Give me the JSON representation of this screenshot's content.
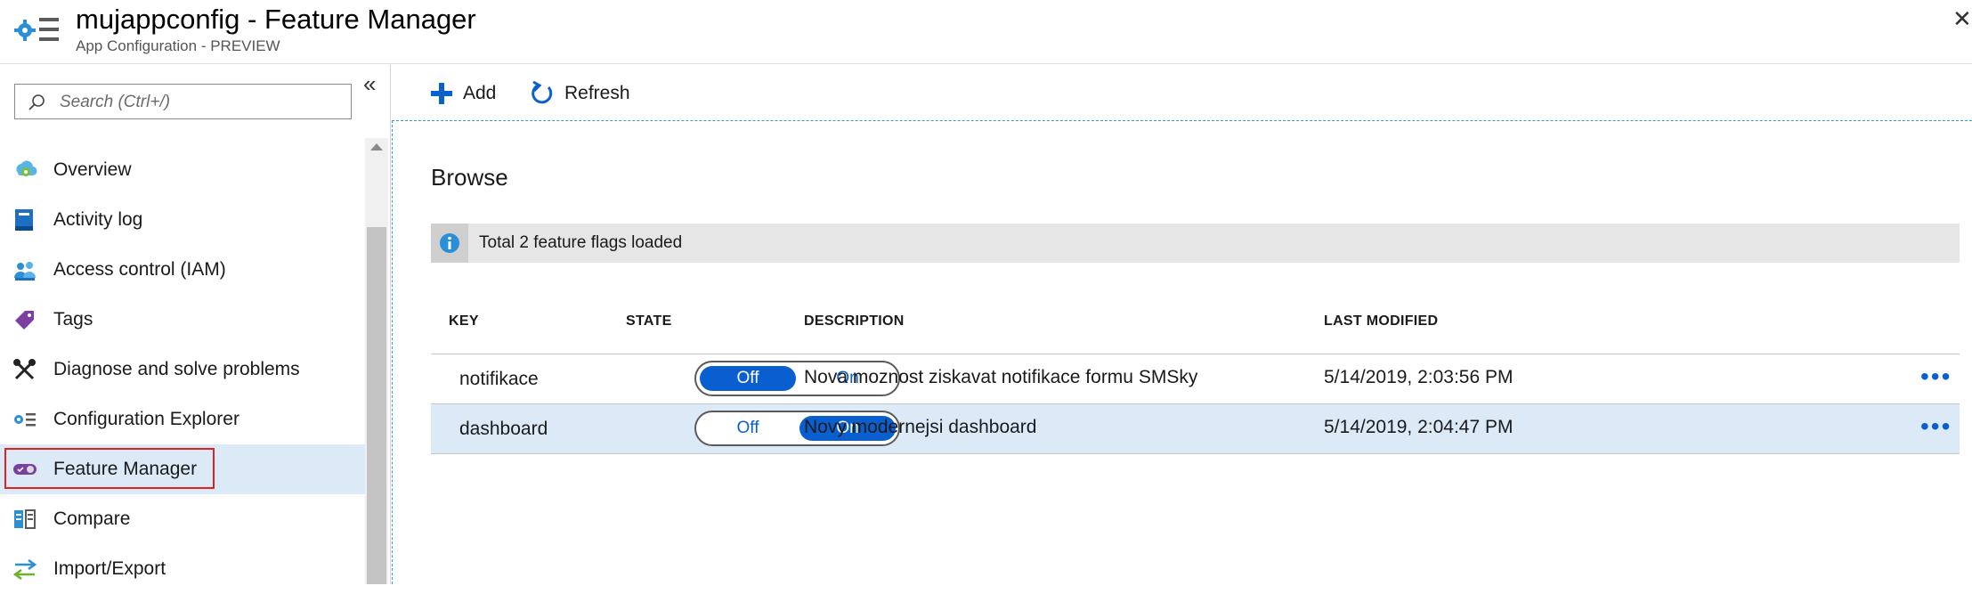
{
  "header": {
    "title": "mujappconfig - Feature Manager",
    "subtitle": "App Configuration - PREVIEW",
    "close_glyph": "✕"
  },
  "sidebar": {
    "search_placeholder": "Search (Ctrl+/)",
    "collapse_glyph": "«",
    "items": [
      {
        "label": "Overview",
        "icon": "overview-icon"
      },
      {
        "label": "Activity log",
        "icon": "activity-log-icon"
      },
      {
        "label": "Access control (IAM)",
        "icon": "access-control-icon"
      },
      {
        "label": "Tags",
        "icon": "tag-icon"
      },
      {
        "label": "Diagnose and solve problems",
        "icon": "wrench-icon"
      },
      {
        "label": "Configuration Explorer",
        "icon": "configuration-explorer-icon"
      },
      {
        "label": "Feature Manager",
        "icon": "feature-manager-icon",
        "active": true
      },
      {
        "label": "Compare",
        "icon": "compare-icon"
      },
      {
        "label": "Import/Export",
        "icon": "import-export-icon"
      }
    ]
  },
  "toolbar": {
    "add_label": "Add",
    "refresh_label": "Refresh"
  },
  "main": {
    "section_title": "Browse",
    "info_text": "Total 2 feature flags loaded",
    "columns": {
      "key": "KEY",
      "state": "STATE",
      "description": "DESCRIPTION",
      "last_modified": "LAST MODIFIED"
    },
    "rows": [
      {
        "key": "notifikace",
        "state": "Off",
        "off_label": "Off",
        "on_label": "On",
        "description": "Nova moznost ziskavat notifikace formu SMSky",
        "last_modified": "5/14/2019, 2:03:56 PM",
        "more": "•••"
      },
      {
        "key": "dashboard",
        "state": "On",
        "off_label": "Off",
        "on_label": "On",
        "description": "Novy modernejsi dashboard",
        "last_modified": "5/14/2019, 2:04:47 PM",
        "more": "•••"
      }
    ]
  },
  "colors": {
    "accent": "#0a5fd0",
    "selected_row": "#dceaf8",
    "highlight_border": "#e0231f"
  }
}
